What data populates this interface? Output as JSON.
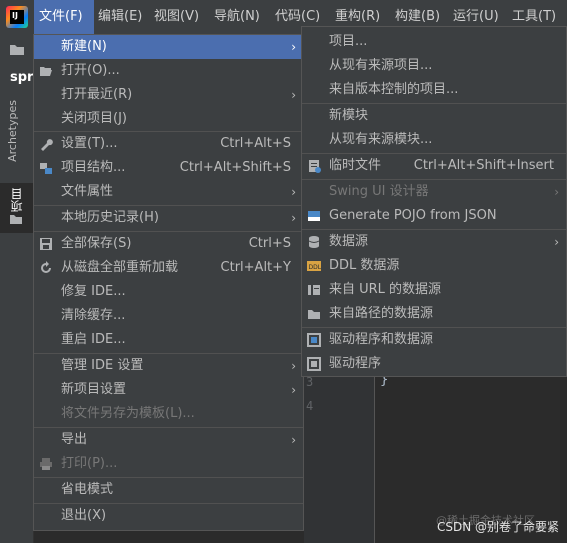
{
  "menubar": {
    "items": [
      {
        "label": "文件(F)"
      },
      {
        "label": "编辑(E)"
      },
      {
        "label": "视图(V)"
      },
      {
        "label": "导航(N)"
      },
      {
        "label": "代码(C)"
      },
      {
        "label": "重构(R)"
      },
      {
        "label": "构建(B)"
      },
      {
        "label": "运行(U)"
      },
      {
        "label": "工具(T)"
      }
    ]
  },
  "app_logo": "IJ",
  "left_strip": {
    "tab_stub": "spr",
    "archetypes": "Archetypes",
    "project": "项目"
  },
  "editor": {
    "line_numbers": [
      "3",
      "4"
    ],
    "code_text": "}"
  },
  "file_menu": {
    "items": [
      {
        "label": "新建(N)",
        "arrow": "›",
        "icon": ""
      },
      {
        "label": "打开(O)...",
        "icon": "folder-open-icon"
      },
      {
        "label": "打开最近(R)",
        "arrow": "›"
      },
      {
        "label": "关闭项目(J)"
      },
      {
        "label": "设置(T)...",
        "shortcut": "Ctrl+Alt+S",
        "icon": "wrench-icon"
      },
      {
        "label": "项目结构...",
        "shortcut": "Ctrl+Alt+Shift+S",
        "icon": "project-structure-icon"
      },
      {
        "label": "文件属性",
        "arrow": "›"
      },
      {
        "label": "本地历史记录(H)",
        "arrow": "›"
      },
      {
        "label": "全部保存(S)",
        "shortcut": "Ctrl+S",
        "icon": "save-icon"
      },
      {
        "label": "从磁盘全部重新加载",
        "shortcut": "Ctrl+Alt+Y",
        "icon": "reload-icon"
      },
      {
        "label": "修复 IDE..."
      },
      {
        "label": "清除缓存..."
      },
      {
        "label": "重启 IDE..."
      },
      {
        "label": "管理 IDE 设置",
        "arrow": "›"
      },
      {
        "label": "新项目设置",
        "arrow": "›"
      },
      {
        "label": "将文件另存为模板(L)..."
      },
      {
        "label": "导出",
        "arrow": "›"
      },
      {
        "label": "打印(P)...",
        "icon": "print-icon"
      },
      {
        "label": "省电模式"
      },
      {
        "label": "退出(X)"
      }
    ]
  },
  "new_submenu": {
    "items": [
      {
        "label": "项目..."
      },
      {
        "label": "从现有来源项目..."
      },
      {
        "label": "来自版本控制的项目..."
      },
      {
        "label": "新模块"
      },
      {
        "label": "从现有来源模块..."
      },
      {
        "label": "临时文件",
        "shortcut": "Ctrl+Alt+Shift+Insert",
        "icon": "scratch-file-icon"
      },
      {
        "label": "Swing UI 设计器",
        "arrow": "›"
      },
      {
        "label": "Generate POJO from JSON",
        "icon": "pojo-icon"
      },
      {
        "label": "数据源",
        "arrow": "›",
        "icon": "database-icon"
      },
      {
        "label": "DDL 数据源",
        "icon": "ddl-icon"
      },
      {
        "label": "来自 URL 的数据源",
        "icon": "url-datasource-icon"
      },
      {
        "label": "来自路径的数据源",
        "icon": "folder-icon"
      },
      {
        "label": "驱动程序和数据源",
        "icon": "driver-datasource-icon"
      },
      {
        "label": "驱动程序",
        "icon": "driver-icon"
      }
    ]
  },
  "watermark": {
    "text": "CSDN @别卷了命要紧",
    "faint": "@稀土掘金技术社区"
  },
  "colors": {
    "selection": "#4b6eaf",
    "menu_bg": "#3c3f41",
    "editor_bg": "#2b2b2b"
  }
}
